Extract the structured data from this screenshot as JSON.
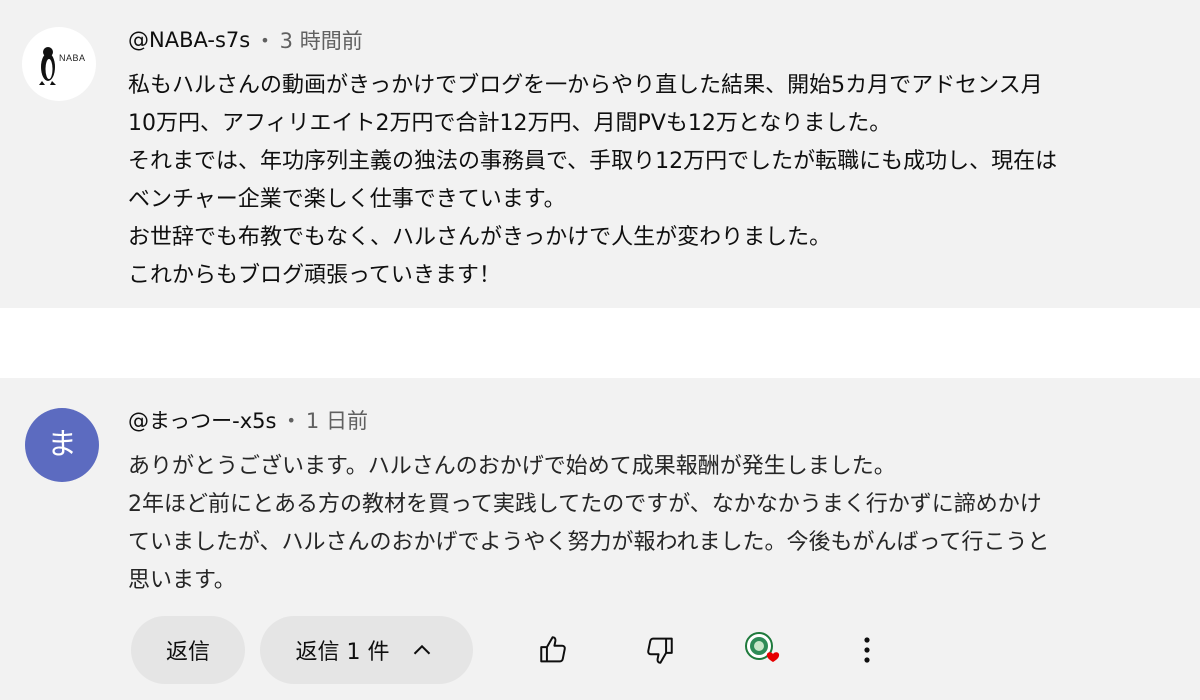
{
  "comments": [
    {
      "author": "@NABA-s7s",
      "separator": "•",
      "time": "3 時間前",
      "avatar_text": "NABA",
      "avatar_icon": "penguin-icon",
      "body": "私もハルさんの動画がきっかけでブログを一からやり直した結果、開始5カ月でアドセンス月\n10万円、アフィリエイト2万円で合計12万円、月間PVも12万となりました。\nそれまでは、年功序列主義の独法の事務員で、手取り12万円でしたが転職にも成功し、現在は\nベンチャー企業で楽しく仕事できています。\nお世辞でも布教でもなく、ハルさんがきっかけで人生が変わりました。\nこれからもブログ頑張っていきます！"
    },
    {
      "author": "@まっつー-x5s",
      "separator": "•",
      "time": "1 日前",
      "avatar_text": "ま",
      "avatar_color": "#5c6bc0",
      "body": "ありがとうございます。ハルさんのおかげで始めて成果報酬が発生しました。\n2年ほど前にとある方の教材を買って実践してたのですが、なかなかうまく行かずに諦めかけ\nていましたが、ハルさんのおかげでようやく努力が報われました。今後もがんばって行こうと\n思います。"
    }
  ],
  "actions": {
    "reply_label": "返信",
    "replies_label": "返信 1 件",
    "like_icon": "thumbs-up-icon",
    "dislike_icon": "thumbs-down-icon",
    "creator_heart_icon": "creator-heart-icon",
    "more_icon": "more-vertical-icon"
  },
  "colors": {
    "background": "#f2f2f2",
    "button_bg": "#e5e5e5",
    "meta_text": "#606060",
    "heart": "#e60000"
  }
}
